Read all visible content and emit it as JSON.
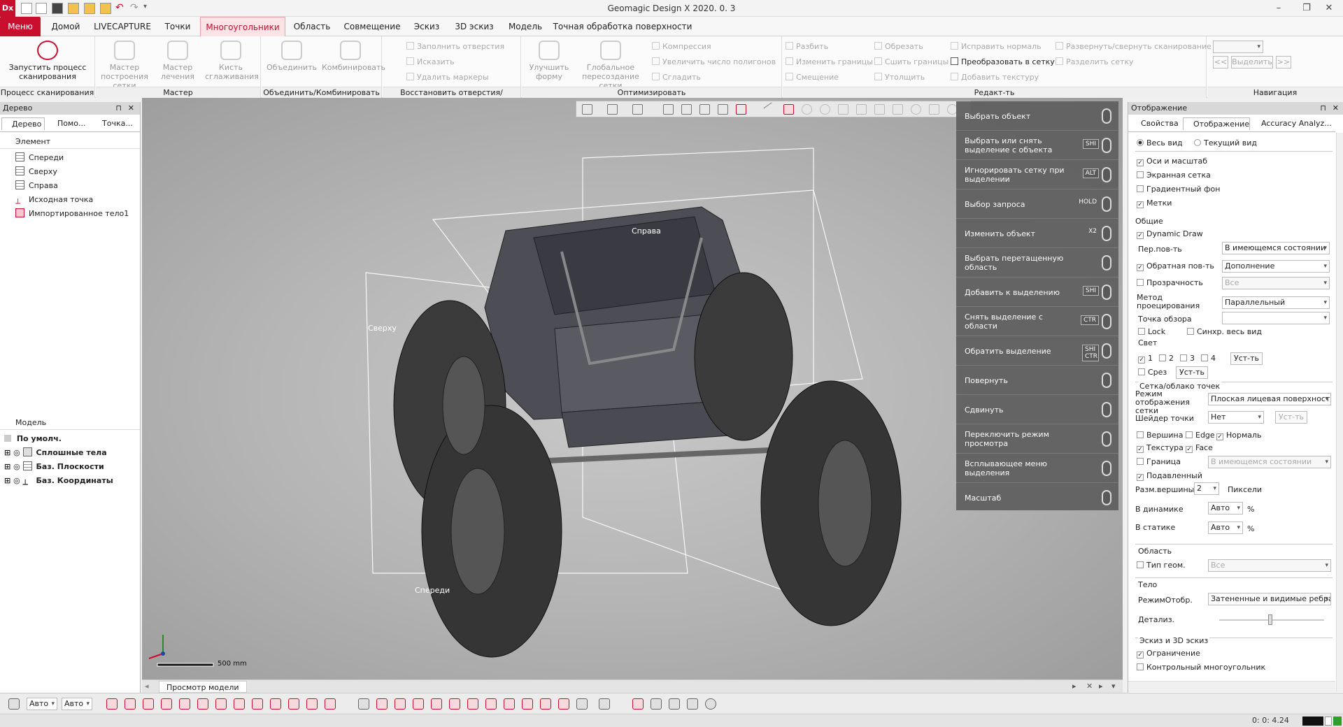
{
  "app": {
    "title": "Geomagic Design X 2020. 0. 3",
    "icon_text": "Dx"
  },
  "menubar": {
    "tabs": [
      "Меню",
      "Домой",
      "LIVECAPTURE",
      "Точки",
      "Многоугольники",
      "Область",
      "Совмещение",
      "Эскиз",
      "3D эскиз",
      "Модель",
      "Точная обработка поверхности"
    ],
    "active": "Многоугольники"
  },
  "ribbon": {
    "groups": [
      {
        "label": "Процесс сканирования",
        "buttons": [
          "Запустить процесс сканирования"
        ]
      },
      {
        "label": "Мастер",
        "buttons": [
          "Мастер построения сетки",
          "Мастер лечения",
          "Кисть сглаживания"
        ]
      },
      {
        "label": "Объединить/Комбинировать",
        "buttons": [
          "Объединить",
          "Комбинировать"
        ]
      },
      {
        "label": "Восстановить отверстия/уплощение",
        "items": [
          "Заполнить отверстия",
          "Исказить",
          "Удалить маркеры"
        ]
      },
      {
        "label": "Оптимизировать",
        "buttons": [
          "Улучшить форму",
          "Глобальное пересоздание сетки"
        ],
        "items": [
          "Компрессия",
          "Увеличить число полигонов",
          "Сгладить"
        ]
      },
      {
        "label": "Редакт-ть",
        "items": [
          "Разбить",
          "Изменить границы",
          "Смещение",
          "Обрезать",
          "Сшить границы",
          "Утолщить",
          "Исправить нормаль",
          "Преобразовать в сетку",
          "Добавить текстуру",
          "Развернуть/свернуть сканирование",
          "Разделить сетку"
        ]
      },
      {
        "label": "Навигация",
        "items": [
          "<<",
          "Выделить",
          ">>"
        ]
      }
    ]
  },
  "left_panel": {
    "title": "Дерево",
    "tabs": [
      "Дерево",
      "Помо...",
      "Точка..."
    ],
    "element_header": "Элемент",
    "tree": [
      "Спереди",
      "Сверху",
      "Справа",
      "Исходная точка",
      "Импортированное тело1"
    ],
    "model_header": "Модель",
    "model_default": "По умолч.",
    "model_items": [
      "Сплошные тела",
      "Баз. Плоскости",
      "Баз. Координаты"
    ]
  },
  "viewport": {
    "plane_labels": {
      "right": "Справа",
      "top": "Сверху",
      "front": "Спереди"
    },
    "scale": "500 mm",
    "tab": "Просмотр модели"
  },
  "mouse_guide": [
    {
      "label": "Выбрать объект",
      "key": ""
    },
    {
      "label": "Выбрать или снять выделение с объекта",
      "key": "SHI"
    },
    {
      "label": "Игнорировать сетку при выделении",
      "key": "ALT"
    },
    {
      "label": "Выбор запроса",
      "key": "HOLD"
    },
    {
      "label": "Изменить объект",
      "key": "X2"
    },
    {
      "label": "Выбрать перетащенную область",
      "key": ""
    },
    {
      "label": "Добавить к выделению",
      "key": "SHI"
    },
    {
      "label": "Снять выделение с области",
      "key": "CTR"
    },
    {
      "label": "Обратить выделение",
      "key": "SHI CTR"
    },
    {
      "label": "Повернуть",
      "key": ""
    },
    {
      "label": "Сдвинуть",
      "key": ""
    },
    {
      "label": "Переключить режим просмотра",
      "key": ""
    },
    {
      "label": "Всплывающее меню выделения",
      "key": ""
    },
    {
      "label": "Масштаб",
      "key": ""
    }
  ],
  "right_panel": {
    "title": "Отображение",
    "tabs": [
      "Свойства",
      "Отображение",
      "Accuracy Analyz..."
    ],
    "view_all": "Весь вид",
    "current_view": "Текущий вид",
    "axes": "Оси и масштаб",
    "screen_grid": "Экранная сетка",
    "gradient_bg": "Градиентный фон",
    "labels": "Метки",
    "general": "Общие",
    "dynamic_draw": "Dynamic Draw",
    "front_face": "Пер.пов-ть",
    "front_face_val": "В имеющемся состоянии",
    "back_face": "Обратная пов-ть",
    "back_face_val": "Дополнение",
    "transparency": "Прозрачность",
    "transparency_val": "Все",
    "projection": "Метод проецирования",
    "projection_val": "Параллельный",
    "viewpoint": "Точка обзора",
    "lock": "Lock",
    "sync": "Синхр. весь вид",
    "light": "Свет",
    "lights": [
      "1",
      "2",
      "3",
      "4"
    ],
    "set": "Уст-ть",
    "clip": "Срез",
    "mesh_section": "Сетка/облако точек",
    "mesh_mode": "Режим отображения сетки",
    "mesh_mode_val": "Плоская лицевая поверхность",
    "point_shader": "Шейдер точки",
    "point_shader_val": "Нет",
    "vertex": "Вершина",
    "edge": "Edge",
    "normal": "Нормаль",
    "texture": "Текстура",
    "face": "Face",
    "border": "Граница",
    "border_val": "В имеющемся состоянии",
    "dimmed": "Подавленный",
    "vertex_size": "Разм.вершины",
    "vertex_size_val": "2",
    "pixels": "Пиксели",
    "dynamic": "В динамике",
    "static": "В статике",
    "auto": "Авто",
    "percent": "%",
    "region": "Область",
    "geom_type": "Тип геом.",
    "geom_type_val": "Все",
    "body": "Тело",
    "display_mode": "РежимОтобр.",
    "display_mode_val": "Затененные и видимые ребра",
    "detail": "Детализ.",
    "sketch": "Эскиз и 3D эскиз",
    "constraint": "Ограничение",
    "control_polygon": "Контрольный многоугольник"
  },
  "bottom": {
    "auto1": "Авто",
    "auto2": "Авто"
  },
  "status": {
    "time": "0: 0: 4.24"
  }
}
